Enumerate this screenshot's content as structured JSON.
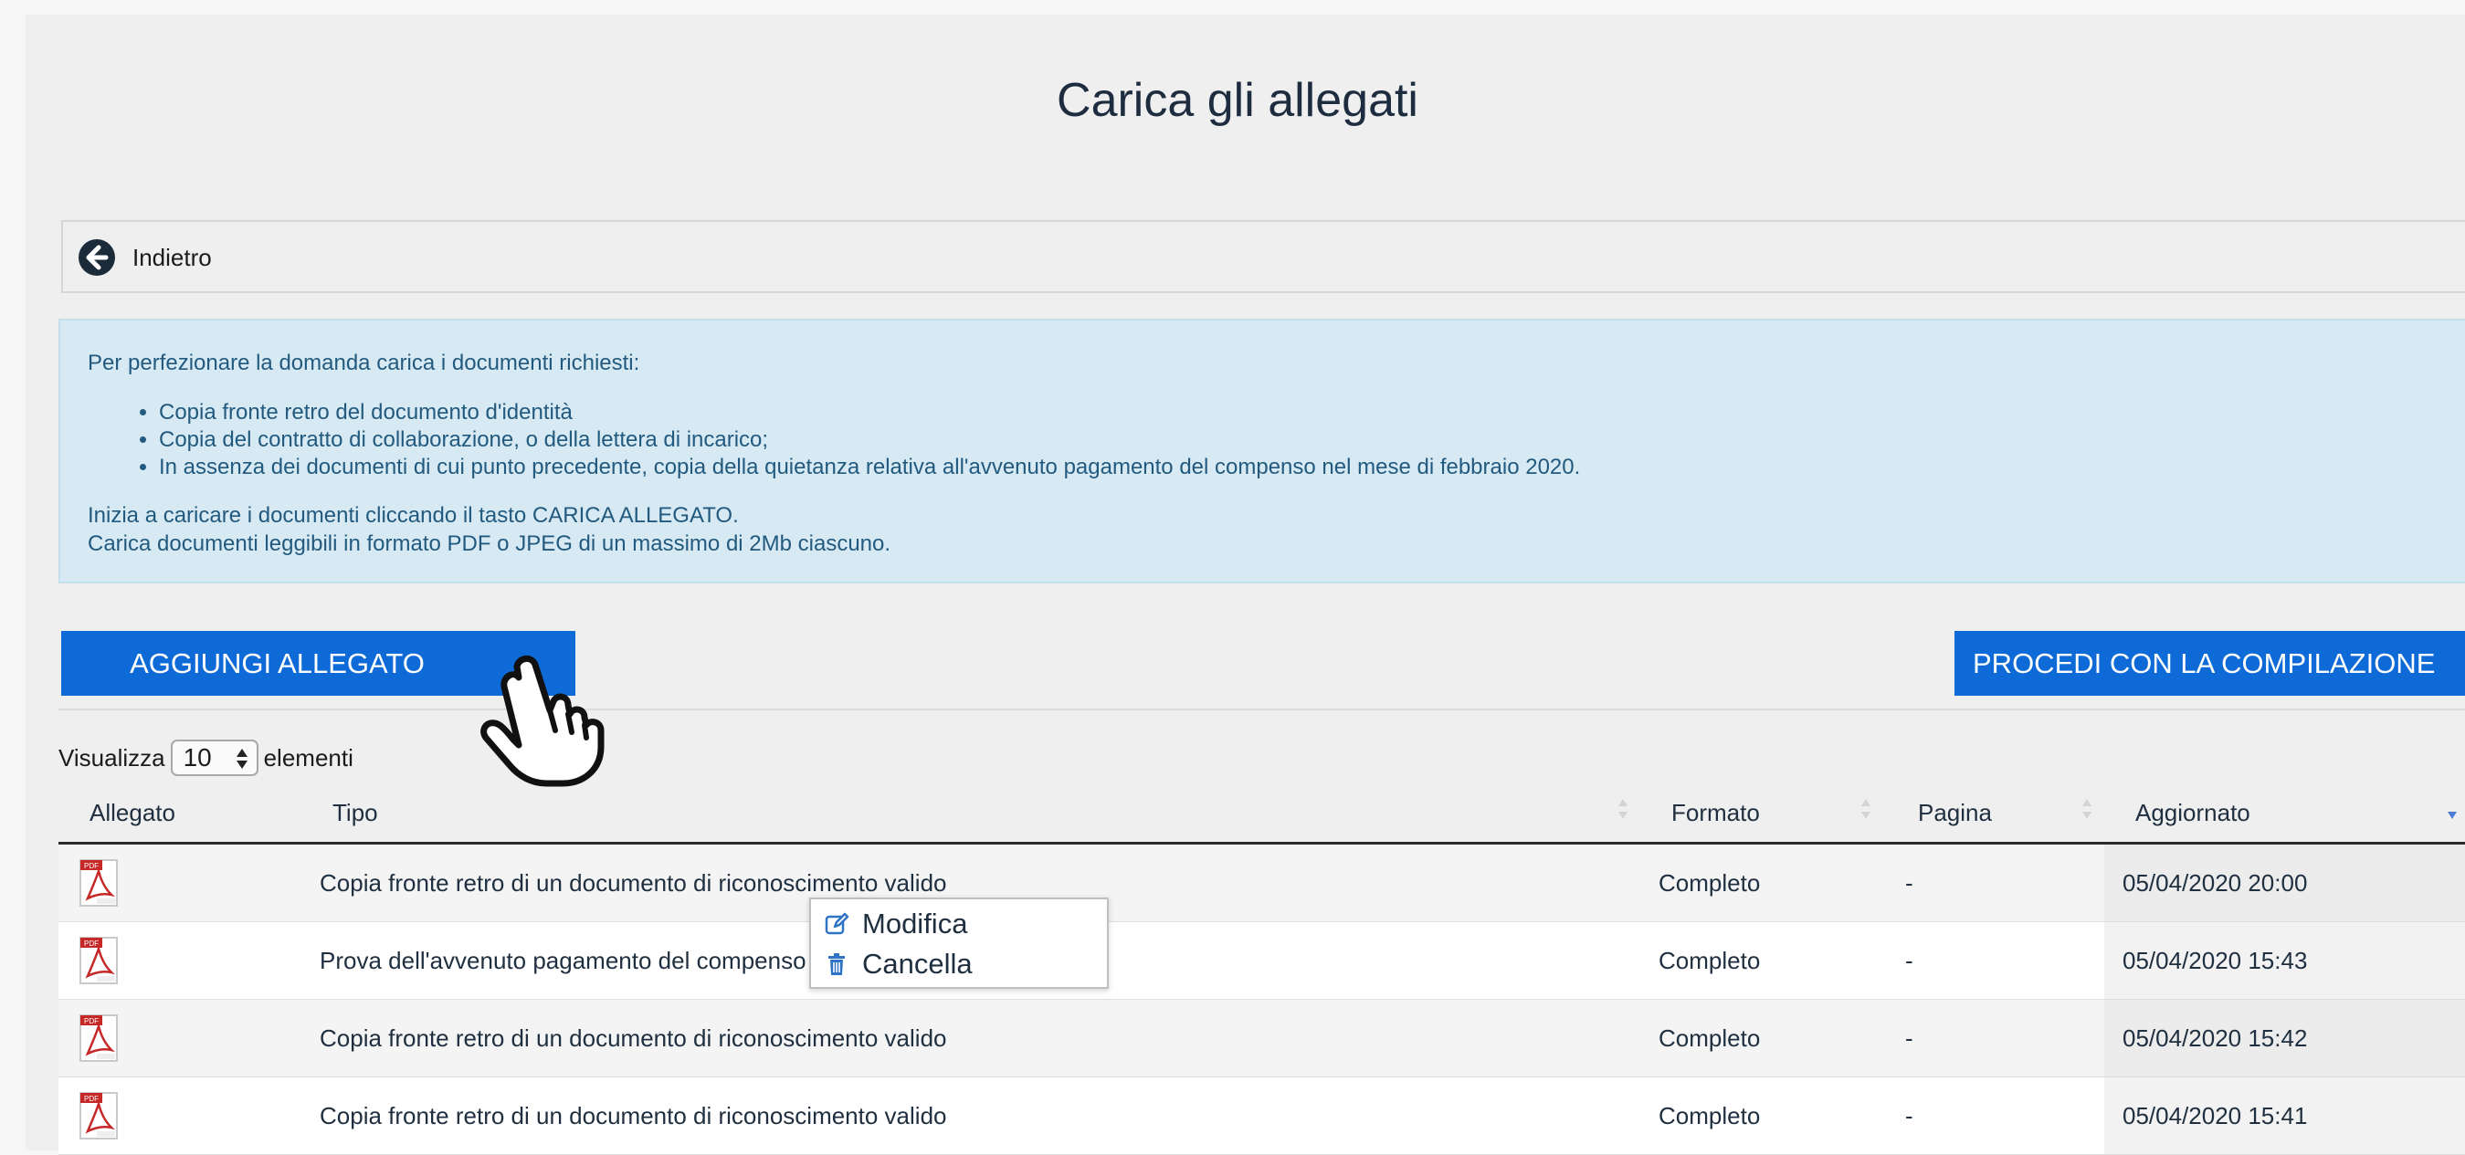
{
  "page": {
    "title": "Carica gli allegati"
  },
  "back": {
    "label": "Indietro",
    "icon": "arrow-circle-left-icon"
  },
  "info": {
    "intro": "Per perfezionare la domanda carica i documenti richiesti:",
    "items": [
      "Copia fronte retro del documento d'identità",
      "Copia del contratto di collaborazione, o della lettera di incarico;",
      "In assenza dei documenti di cui punto precedente, copia della quietanza relativa all'avvenuto pagamento del compenso nel mese di febbraio 2020."
    ],
    "line1": "Inizia a caricare i documenti cliccando il tasto CARICA ALLEGATO.",
    "line2": "Carica documenti leggibili in formato PDF o JPEG di un massimo di 2Mb ciascuno."
  },
  "actions": {
    "add_label": "AGGIUNGI ALLEGATO",
    "proceed_label": "PROCEDI CON LA COMPILAZIONE"
  },
  "table_length": {
    "prefix": "Visualizza",
    "value": "10",
    "suffix": "elementi"
  },
  "table": {
    "columns": [
      "Allegato",
      "Tipo",
      "Formato",
      "Pagina",
      "Aggiornato"
    ],
    "rows": [
      {
        "icon": "pdf-file-icon",
        "tipo": "Copia fronte retro di un documento di riconoscimento valido",
        "formato": "Completo",
        "pagina": "-",
        "aggiornato": "05/04/2020 20:00"
      },
      {
        "icon": "pdf-file-icon",
        "tipo": "Prova dell'avvenuto pagamento del compenso nel mese di febbraio 2020",
        "formato": "Completo",
        "pagina": "-",
        "aggiornato": "05/04/2020 15:43"
      },
      {
        "icon": "pdf-file-icon",
        "tipo": "Copia fronte retro di un documento di riconoscimento valido",
        "formato": "Completo",
        "pagina": "-",
        "aggiornato": "05/04/2020 15:42"
      },
      {
        "icon": "pdf-file-icon",
        "tipo": "Copia fronte retro di un documento di riconoscimento valido",
        "formato": "Completo",
        "pagina": "-",
        "aggiornato": "05/04/2020 15:41"
      }
    ]
  },
  "context_menu": {
    "edit_label": "Modifica",
    "delete_label": "Cancella"
  },
  "colors": {
    "primary": "#0d6ad6",
    "info_bg": "#d7eaf4",
    "info_text": "#225a7f"
  }
}
